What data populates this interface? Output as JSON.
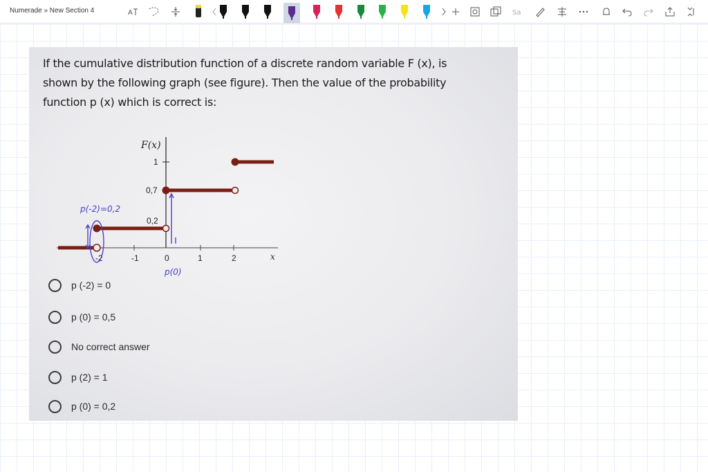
{
  "toolbar": {
    "breadcrumb": "Numerade » New Section 4",
    "colors": {
      "selected_pen": "#5a2d8c",
      "pens": [
        "#222222",
        "#111111",
        "#111111",
        "#111111",
        "#5a2d8c",
        "#d6225a",
        "#e23232",
        "#1a8a3a",
        "#29b24a",
        "#e7e21c",
        "#f7e21c",
        "#1aa6e2"
      ]
    }
  },
  "question": {
    "text_line1": "If the cumulative distribution function of a discrete random variable F (x), is",
    "text_line2": "shown by the following graph (see figure). Then the value of the probability",
    "text_line3": "function p (x) which is correct is:"
  },
  "graph": {
    "y_axis_label": "F(x)",
    "x_axis_label": "x",
    "y_ticks": [
      "1",
      "0,7",
      "0,2"
    ],
    "x_ticks": [
      "-2",
      "-1",
      "0",
      "1",
      "2"
    ],
    "annotations": {
      "p_minus2": "p(-2)=0,2",
      "p_zero": "p(0)"
    },
    "colors": {
      "step": "#7a1d12",
      "ink": "#4a3ec8"
    }
  },
  "options": [
    {
      "label": "p (-2) = 0"
    },
    {
      "label": "p (0) = 0,5"
    },
    {
      "label": "No correct answer"
    },
    {
      "label": "p (2) = 1"
    },
    {
      "label": "p (0) = 0,2"
    }
  ]
}
